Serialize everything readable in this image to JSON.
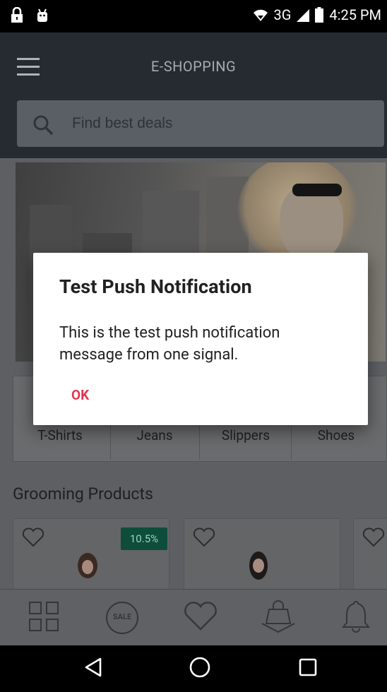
{
  "status_bar": {
    "network": "3G",
    "time": "4:25 PM"
  },
  "app_bar": {
    "title": "E-SHOPPING"
  },
  "search": {
    "placeholder": "Find best deals"
  },
  "categories": [
    {
      "label": "T-Shirts"
    },
    {
      "label": "Jeans"
    },
    {
      "label": "Slippers"
    },
    {
      "label": "Shoes"
    }
  ],
  "section": {
    "title": "Grooming Products"
  },
  "products": [
    {
      "discount": "10.5%"
    }
  ],
  "tabs": [
    {
      "icon": "grid-icon"
    },
    {
      "icon": "sale-icon",
      "label": "SALE"
    },
    {
      "icon": "heart-icon"
    },
    {
      "icon": "shopping-bag-icon"
    },
    {
      "icon": "bell-icon"
    }
  ],
  "dialog": {
    "title": "Test Push Notification",
    "message": "This is the test push notification message from one signal.",
    "ok_label": "OK"
  },
  "colors": {
    "accent": "#e0374f",
    "app_bar": "#262b31",
    "badge": "#0d4d3a"
  }
}
